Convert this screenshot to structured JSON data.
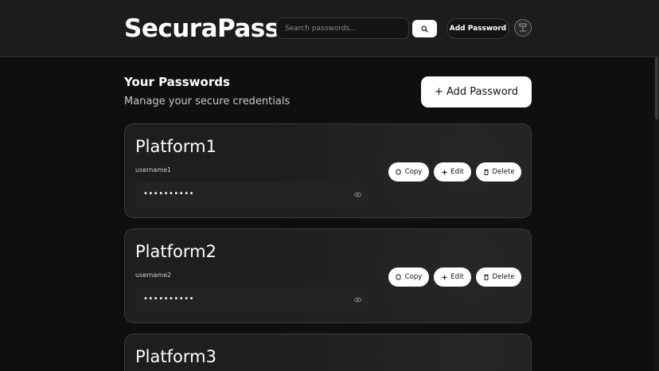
{
  "header": {
    "brand": "SecuraPass",
    "search_placeholder": "Search passwords...",
    "add_label": "Add Password"
  },
  "section": {
    "title": "Your Passwords",
    "subtitle": "Manage your secure credentials",
    "add_label": "+ Add Password"
  },
  "actions": {
    "copy": "Copy",
    "edit": "Edit",
    "delete": "Delete"
  },
  "entries": [
    {
      "platform": "Platform1",
      "username": "username1",
      "masked": "••••••••••"
    },
    {
      "platform": "Platform2",
      "username": "username2",
      "masked": "••••••••••"
    },
    {
      "platform": "Platform3",
      "username": "",
      "masked": ""
    }
  ],
  "colors": {
    "background": "#0f0f0f",
    "header": "#1c1c1c",
    "card": "#1e1e1e",
    "accent": "#ffffff"
  },
  "icons": {
    "search": "search-icon",
    "avatar": "user-avatar-icon",
    "copy": "copy-icon",
    "edit": "plus-icon",
    "delete": "trash-icon",
    "reveal": "eye-icon"
  }
}
